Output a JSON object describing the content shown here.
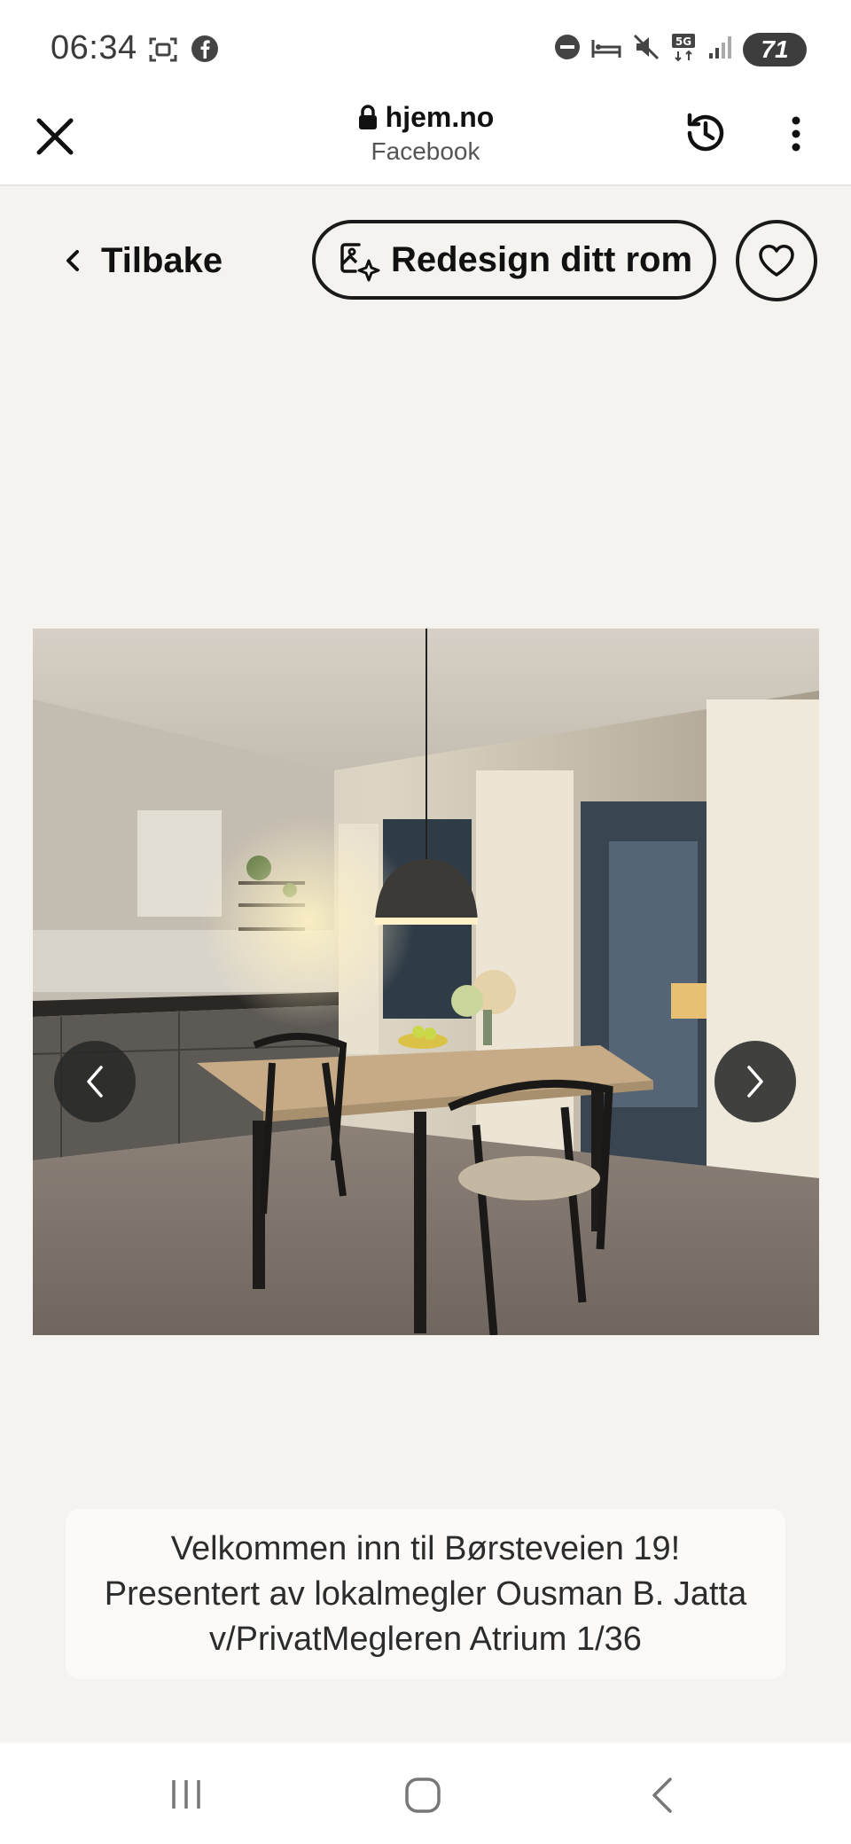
{
  "status_bar": {
    "time": "06:34",
    "battery": "71",
    "left_icons": [
      "screenshot-icon",
      "facebook-icon"
    ],
    "right_icons": [
      "do-not-disturb-icon",
      "sleep-mode-icon",
      "mute-icon",
      "5g-icon",
      "signal-icon",
      "battery-icon"
    ]
  },
  "browser": {
    "url": "hjem.no",
    "subtitle": "Facebook",
    "icons": [
      "close-icon",
      "lock-icon",
      "history-icon",
      "more-vertical-icon"
    ]
  },
  "toolbar": {
    "back_label": "Tilbake",
    "redesign_label": "Redesign ditt rom",
    "icons": [
      "chevron-left-icon",
      "ai-redesign-icon",
      "heart-icon"
    ]
  },
  "gallery": {
    "image_alt": "Kjøkken og spisestue",
    "prev_icon": "chevron-left-icon",
    "next_icon": "chevron-right-icon"
  },
  "caption": {
    "text": "Velkommen inn til Børsteveien 19! Presentert av lokalmegler Ousman B. Jatta v/PrivatMegleren Atrium 1/36"
  },
  "system_nav": {
    "icons": [
      "recents-icon",
      "home-icon",
      "back-icon"
    ]
  },
  "colors": {
    "background": "#f4f3f0",
    "text": "#1b1b1b",
    "arrow_bg": "#282828"
  }
}
